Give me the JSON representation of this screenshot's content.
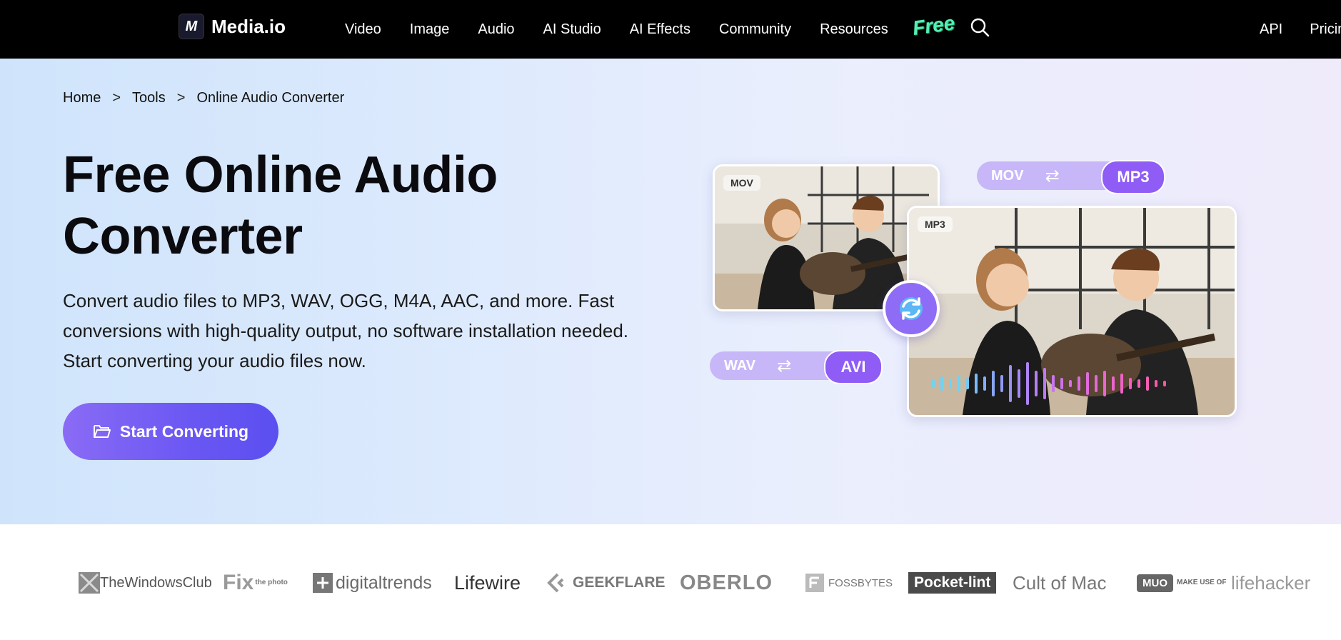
{
  "nav": {
    "logo_mark": "M",
    "logo_text": "Media.io",
    "menu": [
      "Video",
      "Image",
      "Audio",
      "AI Studio",
      "AI Effects",
      "Community",
      "Resources"
    ],
    "free_badge": "Free",
    "search_icon": "search-icon",
    "right_links": [
      "API",
      "Pricin"
    ]
  },
  "breadcrumb": {
    "items": [
      "Home",
      "Tools",
      "Online Audio Converter"
    ],
    "separator": ">"
  },
  "hero": {
    "title": "Free Online Audio Converter",
    "description": "Convert audio files to MP3, WAV, OGG, M4A, AAC, and more. Fast conversions with high-quality output, no software installation needed. Start converting your audio files now.",
    "cta_label": "Start Converting",
    "cta_icon": "folder-open-icon"
  },
  "illustration": {
    "small_card_label": "MOV",
    "big_card_label": "MP3",
    "pill_top": {
      "from": "MOV",
      "arrow": "⇄",
      "to": "MP3"
    },
    "pill_bottom": {
      "from": "WAV",
      "arrow": "⇄",
      "to": "AVI"
    },
    "swap_icon": "refresh-icon"
  },
  "press_logos": [
    "TheWindowsClub",
    "Fix",
    "digitaltrends",
    "Lifewire",
    "GEEKFLARE",
    "OBERLO",
    "FOSSBYTES",
    "Pocket-lint",
    "Cult of Mac",
    "MUO",
    "lifehacker"
  ],
  "press_logo_fix_sub": "the photo",
  "press_logo_muo_sub": "MAKE USE OF",
  "colors": {
    "accent": "#6a57f3",
    "accent_purple": "#8f5cf5",
    "free_green": "#53f0b0",
    "nav_bg": "#000000"
  }
}
